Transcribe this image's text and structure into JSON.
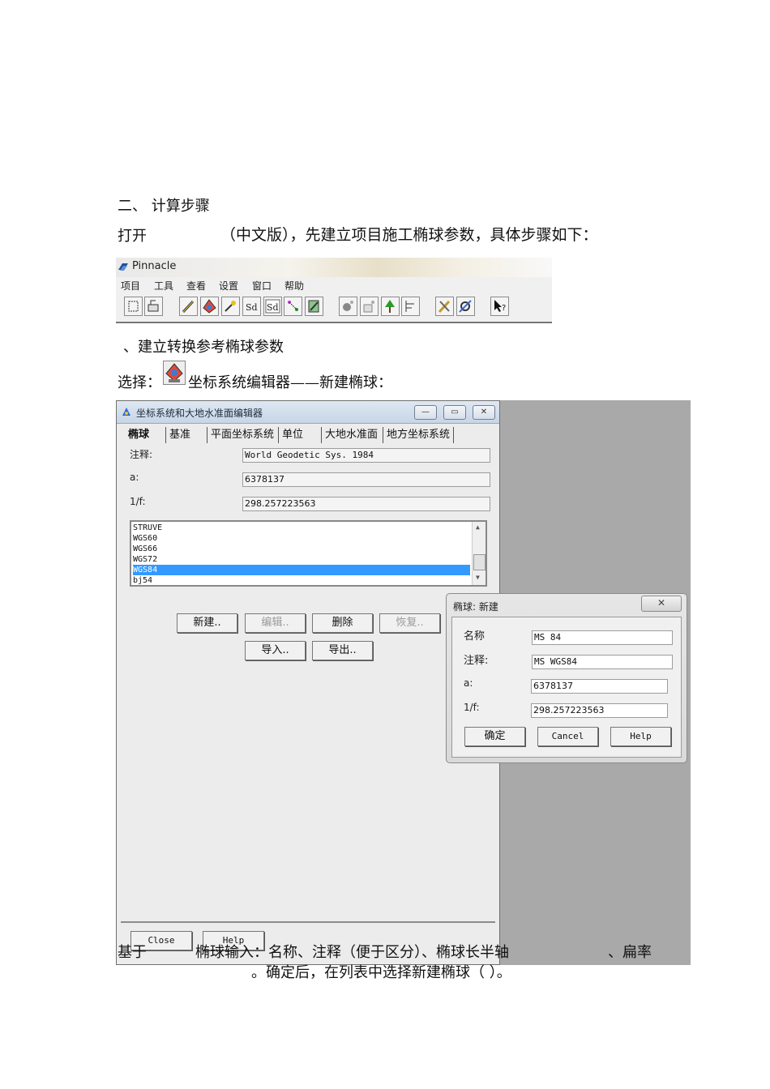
{
  "doc": {
    "step_heading": "二、    计算步骤",
    "open_line_prefix": "打开",
    "open_line_rest": "（中文版），先建立项目施工椭球参数，具体步骤如下：",
    "sub_heading": "、建立转换参考椭球参数",
    "select_prefix": "选择：",
    "select_rest": "坐标系统编辑器——新建椭球：",
    "bottom_line1_a": "基于",
    "bottom_line1_b": "椭球输入：名称、注释（便于区分）、椭球长半轴",
    "bottom_line1_c": "、扁率",
    "bottom_line2": "。确定后，在列表中选择新建椭球（          ）。"
  },
  "pinnacle": {
    "title": "Pinnacle",
    "menu": [
      "项目",
      "工具",
      "查看",
      "设置",
      "窗口",
      "帮助"
    ]
  },
  "editor": {
    "title": "坐标系统和大地水准面编辑器",
    "tabs": [
      "椭球",
      "基准",
      "平面坐标系统",
      "单位",
      "大地水准面",
      "地方坐标系统"
    ],
    "fields": {
      "comment_label": "注释:",
      "comment_value": "World Geodetic Sys. 1984",
      "a_label": "a:",
      "a_value": "6378137",
      "f_label": "1/f:",
      "f_value": "298.257223563"
    },
    "list": [
      "STRUVE",
      "WGS60",
      "WGS66",
      "WGS72",
      "WGS84",
      "bj54"
    ],
    "selected_index": 4,
    "buttons": {
      "new": "新建..",
      "edit": "编辑..",
      "delete": "删除",
      "restore": "恢复..",
      "import": "导入..",
      "export": "导出.."
    },
    "bottom_buttons": {
      "close": "Close",
      "help": "Help"
    }
  },
  "dialog": {
    "title": "椭球: 新建",
    "name_label": "名称",
    "name_value": "MS 84",
    "comment_label": "注释:",
    "comment_value": "MS WGS84",
    "a_label": "a:",
    "a_value": "6378137",
    "f_label": "1/f:",
    "f_value": "298.257223563",
    "ok": "确定",
    "cancel": "Cancel",
    "help": "Help"
  }
}
